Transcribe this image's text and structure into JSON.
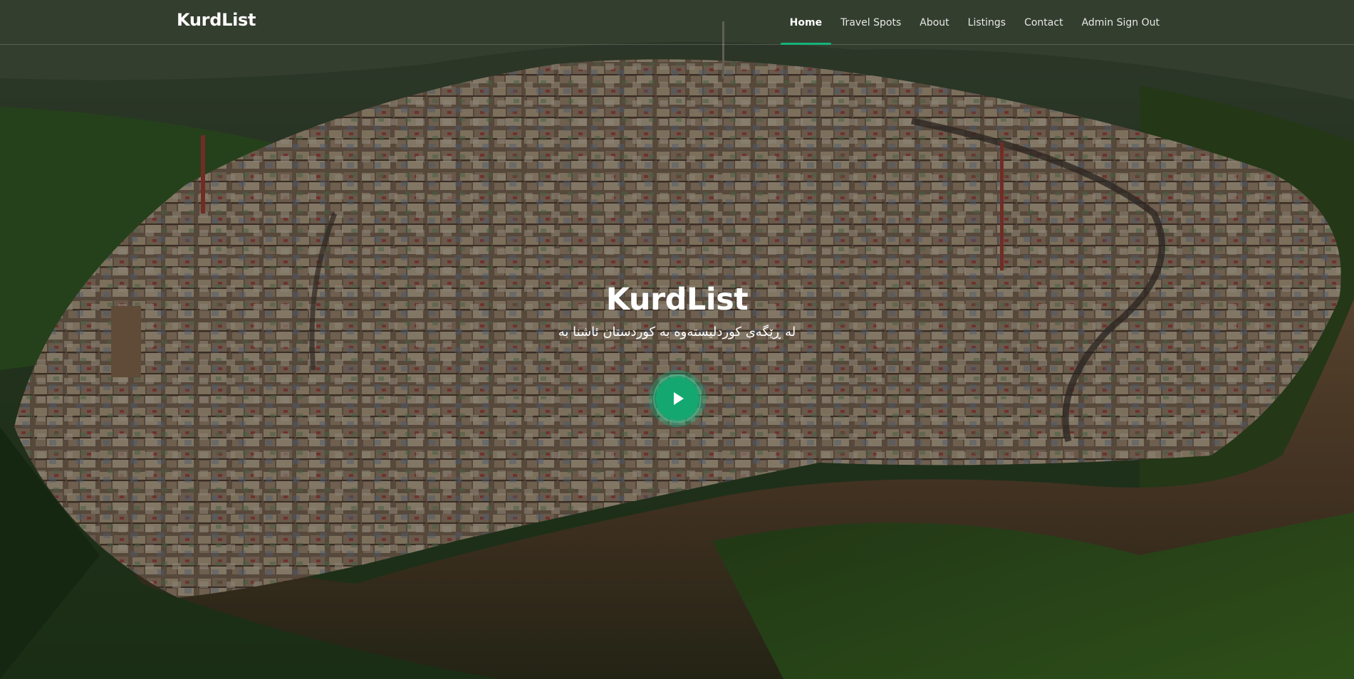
{
  "header": {
    "brand": "KurdList",
    "nav": [
      {
        "label": "Home",
        "active": true
      },
      {
        "label": "Travel Spots",
        "active": false
      },
      {
        "label": "About",
        "active": false
      },
      {
        "label": "Listings",
        "active": false
      },
      {
        "label": "Contact",
        "active": false
      },
      {
        "label": "Admin Sign Out",
        "active": false
      }
    ]
  },
  "hero": {
    "title": "KurdList",
    "subtitle": "لە ڕێگەی کوردلیستەوە بە کوردستان ئاشنا بە",
    "play_icon": "play-icon"
  },
  "colors": {
    "accent": "#14b37a",
    "overlay": "rgba(0,0,0,0.38)"
  }
}
